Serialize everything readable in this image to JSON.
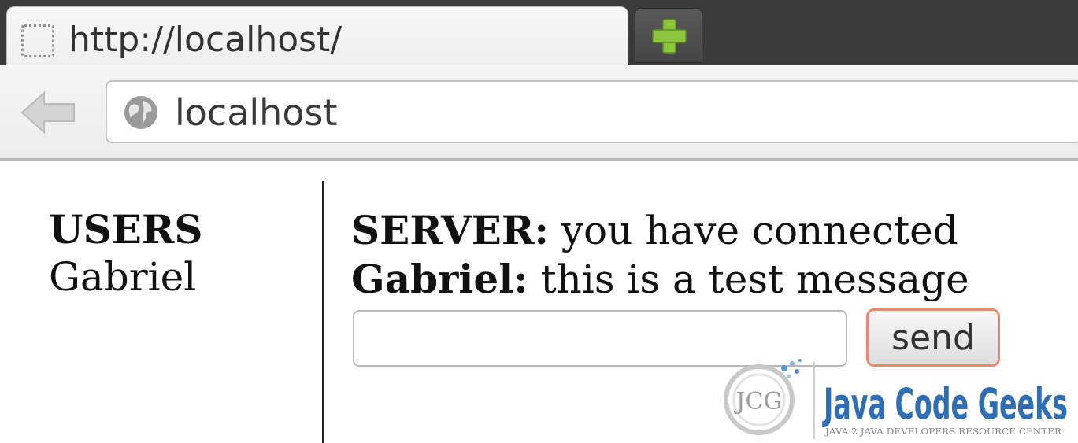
{
  "browser": {
    "tab_title": "http://localhost/",
    "address": "localhost"
  },
  "users": {
    "heading": "USERS",
    "list": [
      "Gabriel"
    ]
  },
  "chat": {
    "messages": [
      {
        "sender": "SERVER:",
        "text": " you have connected"
      },
      {
        "sender": "Gabriel:",
        "text": " this is a test message"
      }
    ],
    "input_value": "",
    "send_label": "send"
  },
  "watermark": {
    "brand": "Java Code Geeks",
    "tagline": "Java 2 Java Developers Resource Center",
    "badge": "JCG"
  },
  "colors": {
    "tabstrip": "#3b3b3b",
    "send_border": "#e98a6e",
    "brand_blue": "#2f6db5",
    "plus_green": "#8cc63f"
  }
}
